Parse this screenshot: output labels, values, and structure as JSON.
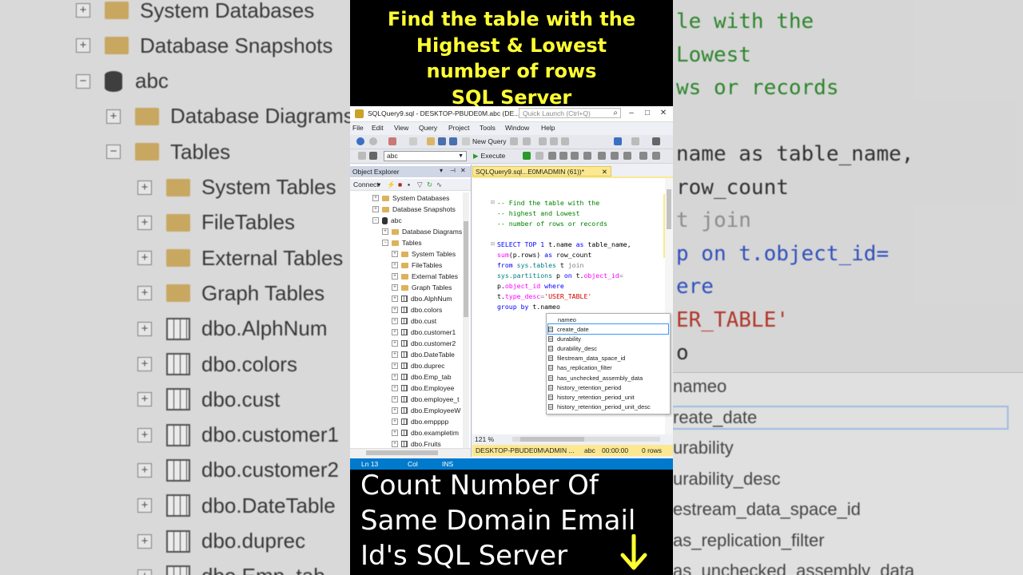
{
  "video_title": {
    "line1": "Find the table with the",
    "line2": "Highest & Lowest",
    "line3": "number of rows",
    "line4": "SQL Server"
  },
  "bottom_caption": {
    "line1": "Count Number Of",
    "line2": "Same Domain Email",
    "line3": "Id's SQL Server",
    "arrow_icon": "down-arrow-icon",
    "arrow_color": "#ffff33"
  },
  "window": {
    "title": "SQLQuery9.sql - DESKTOP-PBUDE0M.abc (DE...",
    "quick_launch_placeholder": "Quick Launch (Ctrl+Q)"
  },
  "menu": [
    "File",
    "Edit",
    "View",
    "Query",
    "Project",
    "Tools",
    "Window",
    "Help"
  ],
  "toolbar": {
    "new_query_label": "New Query",
    "database_selected": "abc",
    "execute_label": "Execute"
  },
  "object_explorer": {
    "title": "Object Explorer",
    "connect_label": "Connect",
    "tree": [
      {
        "label": "System Databases",
        "level": 1,
        "icon": "folder-icon",
        "expander": "+"
      },
      {
        "label": "Database Snapshots",
        "level": 1,
        "icon": "folder-icon",
        "expander": "+"
      },
      {
        "label": "abc",
        "level": 1,
        "icon": "database-icon",
        "expander": "-"
      },
      {
        "label": "Database Diagrams",
        "level": 2,
        "icon": "folder-icon",
        "expander": "+"
      },
      {
        "label": "Tables",
        "level": 2,
        "icon": "folder-icon",
        "expander": "-"
      },
      {
        "label": "System Tables",
        "level": 3,
        "icon": "folder-icon",
        "expander": "+"
      },
      {
        "label": "FileTables",
        "level": 3,
        "icon": "folder-icon",
        "expander": "+"
      },
      {
        "label": "External Tables",
        "level": 3,
        "icon": "folder-icon",
        "expander": "+"
      },
      {
        "label": "Graph Tables",
        "level": 3,
        "icon": "folder-icon",
        "expander": "+"
      },
      {
        "label": "dbo.AlphNum",
        "level": 3,
        "icon": "table-icon",
        "expander": "+"
      },
      {
        "label": "dbo.colors",
        "level": 3,
        "icon": "table-icon",
        "expander": "+"
      },
      {
        "label": "dbo.cust",
        "level": 3,
        "icon": "table-icon",
        "expander": "+"
      },
      {
        "label": "dbo.customer1",
        "level": 3,
        "icon": "table-icon",
        "expander": "+"
      },
      {
        "label": "dbo.customer2",
        "level": 3,
        "icon": "table-icon",
        "expander": "+"
      },
      {
        "label": "dbo.DateTable",
        "level": 3,
        "icon": "table-icon",
        "expander": "+"
      },
      {
        "label": "dbo.duprec",
        "level": 3,
        "icon": "table-icon",
        "expander": "+"
      },
      {
        "label": "dbo.Emp_tab",
        "level": 3,
        "icon": "table-icon",
        "expander": "+"
      },
      {
        "label": "dbo.Employee",
        "level": 3,
        "icon": "table-icon",
        "expander": "+"
      },
      {
        "label": "dbo.employee_t",
        "level": 3,
        "icon": "table-icon",
        "expander": "+"
      },
      {
        "label": "dbo.EmployeeW",
        "level": 3,
        "icon": "table-icon",
        "expander": "+"
      },
      {
        "label": "dbo.empppp",
        "level": 3,
        "icon": "table-icon",
        "expander": "+"
      },
      {
        "label": "dbo.exampletim",
        "level": 3,
        "icon": "table-icon",
        "expander": "+"
      },
      {
        "label": "dbo.Fruits",
        "level": 3,
        "icon": "table-icon",
        "expander": "+"
      }
    ]
  },
  "editor": {
    "tab_label": "SQLQuery9.sql...E0M\\ADMIN (61))*",
    "code": [
      [
        {
          "t": "-- Find the table with the",
          "c": "com"
        }
      ],
      [
        {
          "t": "-- highest and Lowest",
          "c": "com"
        }
      ],
      [
        {
          "t": "-- number of rows or records",
          "c": "com"
        }
      ],
      [],
      [
        {
          "t": "SELECT TOP 1 ",
          "c": "kw"
        },
        {
          "t": "t.name ",
          "c": "pl"
        },
        {
          "t": "as ",
          "c": "kw"
        },
        {
          "t": "table_name,",
          "c": "pl"
        }
      ],
      [
        {
          "t": "sum",
          "c": "fn"
        },
        {
          "t": "(p.rows) ",
          "c": "pl"
        },
        {
          "t": "as ",
          "c": "kw"
        },
        {
          "t": "row_count",
          "c": "pl"
        }
      ],
      [
        {
          "t": "from ",
          "c": "kw"
        },
        {
          "t": "sys.tables ",
          "c": "sys"
        },
        {
          "t": "t ",
          "c": "pl"
        },
        {
          "t": "join",
          "c": "gray"
        }
      ],
      [
        {
          "t": "sys.partitions ",
          "c": "sys"
        },
        {
          "t": "p ",
          "c": "pl"
        },
        {
          "t": "on ",
          "c": "kw"
        },
        {
          "t": "t.",
          "c": "pl"
        },
        {
          "t": "object_id",
          "c": "fn"
        },
        {
          "t": "=",
          "c": "gray"
        }
      ],
      [
        {
          "t": "p.",
          "c": "pl"
        },
        {
          "t": "object_id ",
          "c": "fn"
        },
        {
          "t": "where",
          "c": "kw"
        }
      ],
      [
        {
          "t": "t.",
          "c": "pl"
        },
        {
          "t": "type_desc",
          "c": "fn"
        },
        {
          "t": "=",
          "c": "gray"
        },
        {
          "t": "'USER_TABLE'",
          "c": "str"
        }
      ],
      [
        {
          "t": "group by ",
          "c": "kw"
        },
        {
          "t": "t.nameo",
          "c": "pl"
        }
      ]
    ],
    "zoom": "121 %",
    "autocomplete_typed": "nameo",
    "autocomplete_items": [
      "create_date",
      "durability",
      "durability_desc",
      "filestream_data_space_id",
      "has_replication_filter",
      "has_unchecked_assembly_data",
      "history_retention_period",
      "history_retention_period_unit",
      "history_retention_period_unit_desc"
    ],
    "autocomplete_selected": 0
  },
  "query_status": {
    "server": "DESKTOP-PBUDE0M\\ADMIN ...",
    "database": "abc",
    "elapsed": "00:00:00",
    "rows": "0 rows"
  },
  "status_bar": {
    "line": "Ln 13",
    "col": "Col",
    "mode": "INS"
  },
  "background_left": [
    "System Databases",
    "Database Snapshots",
    "abc",
    "Database Diagrams",
    "Tables",
    "System Tables",
    "FileTables",
    "External Tables",
    "Graph Tables",
    "dbo.AlphNum",
    "dbo.colors",
    "dbo.cust",
    "dbo.customer1",
    "dbo.customer2",
    "dbo.DateTable",
    "dbo.duprec",
    "dbo.Emp_tab"
  ],
  "background_right": {
    "code": [
      "le with the",
      "Lowest",
      "ws or records",
      "",
      "name as table_name,",
      "row_count",
      "t join",
      "p on t.object_id=",
      "ere",
      "ER_TABLE'",
      "o"
    ],
    "list": [
      "nameo",
      "reate_date",
      "urability",
      "urability_desc",
      "estream_data_space_id",
      "as_replication_filter",
      "as_unchecked_assembly_data"
    ]
  },
  "colors": {
    "title_yellow": "#ffff33",
    "tab_yellow": "#fce890",
    "status_blue": "#007acc"
  }
}
